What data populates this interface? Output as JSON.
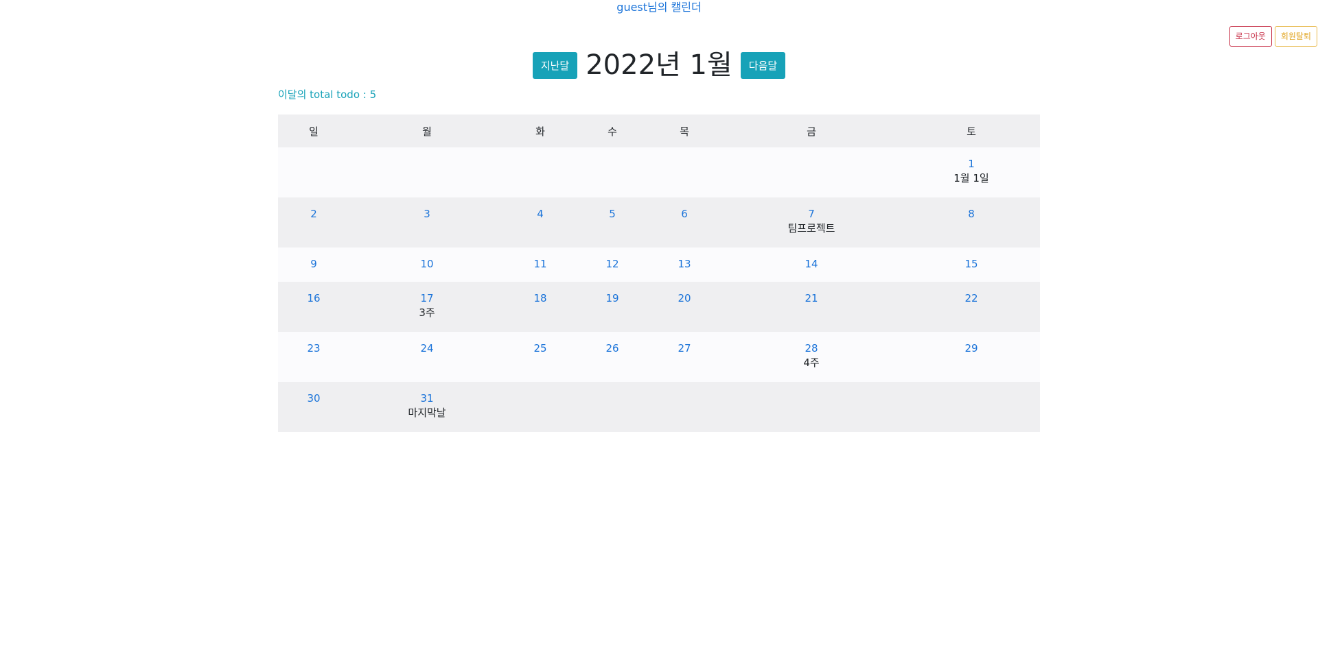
{
  "header": {
    "title": "guest님의 캘린더",
    "logout_label": "로그아웃",
    "withdraw_label": "회원탈퇴"
  },
  "nav": {
    "prev_label": "지난달",
    "next_label": "다음달",
    "month_title": "2022년 1월"
  },
  "summary": {
    "total_todo": "이달의 total todo : 5"
  },
  "colors": {
    "accent": "#17a2b8",
    "link": "#1a73d9",
    "danger": "#c8324a",
    "warning": "#e0a21a"
  },
  "calendar": {
    "weekdays": [
      "일",
      "월",
      "화",
      "수",
      "목",
      "금",
      "토"
    ],
    "weeks": [
      [
        "",
        "",
        "",
        "",
        "",
        "",
        "1"
      ],
      [
        "2",
        "3",
        "4",
        "5",
        "6",
        "7",
        "8"
      ],
      [
        "9",
        "10",
        "11",
        "12",
        "13",
        "14",
        "15"
      ],
      [
        "16",
        "17",
        "18",
        "19",
        "20",
        "21",
        "22"
      ],
      [
        "23",
        "24",
        "25",
        "26",
        "27",
        "28",
        "29"
      ],
      [
        "30",
        "31",
        "",
        "",
        "",
        "",
        ""
      ]
    ],
    "todos": {
      "1": "1월 1일",
      "7": "팀프로젝트",
      "17": "3주",
      "28": "4주",
      "31": "마지막날"
    }
  }
}
